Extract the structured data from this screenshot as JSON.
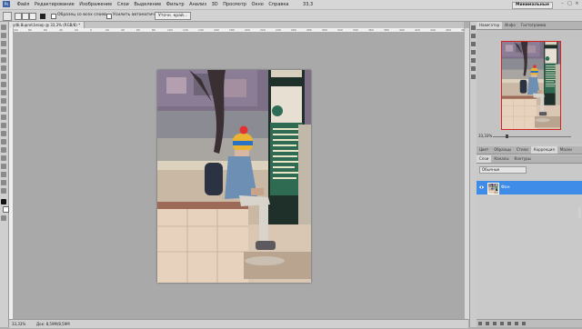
{
  "menubar": {
    "logo": "Ps",
    "items": [
      "Файл",
      "Редактирование",
      "Изображение",
      "Слои",
      "Выделение",
      "Фильтр",
      "Анализ",
      "3D",
      "Просмотр",
      "Окно",
      "Справка"
    ],
    "zoom_value": "33,3",
    "workspace_label": "Минимальные"
  },
  "options": {
    "sample_all_label": "Образец со всех слоев",
    "auto_enhance_label": "Усилить автоматически",
    "refine_edge_label": "Уточн. край..."
  },
  "document": {
    "tab_title": "ydb.8uprot.broop @ 33,3% (RGB/8) *"
  },
  "ruler": {
    "ticks": [
      "100",
      "80",
      "60",
      "40",
      "20",
      "0",
      "20",
      "40",
      "60",
      "80",
      "100",
      "120",
      "140",
      "160",
      "180",
      "200",
      "220",
      "240",
      "260",
      "280",
      "300",
      "320",
      "340",
      "360",
      "380",
      "400",
      "420",
      "440",
      "460",
      "480"
    ]
  },
  "status": {
    "zoom": "33,33%",
    "doc_size": "Док: 8,59M/8,59M"
  },
  "panel": {
    "navigator_tabs": [
      "Навигатор",
      "Инфо",
      "Гистограмма"
    ],
    "navigator_zoom": "33,33%",
    "adjust_tabs": [
      "Цвет",
      "Образцы",
      "Стили",
      "Коррекция",
      "Маски"
    ],
    "layers_tabs": [
      "Слои",
      "Каналы",
      "Контуры"
    ],
    "blend_mode": "Обычные",
    "layer_name": "Фон"
  },
  "colors": {
    "selection_blue": "#3e8ce7",
    "navigator_frame": "#d62121"
  }
}
